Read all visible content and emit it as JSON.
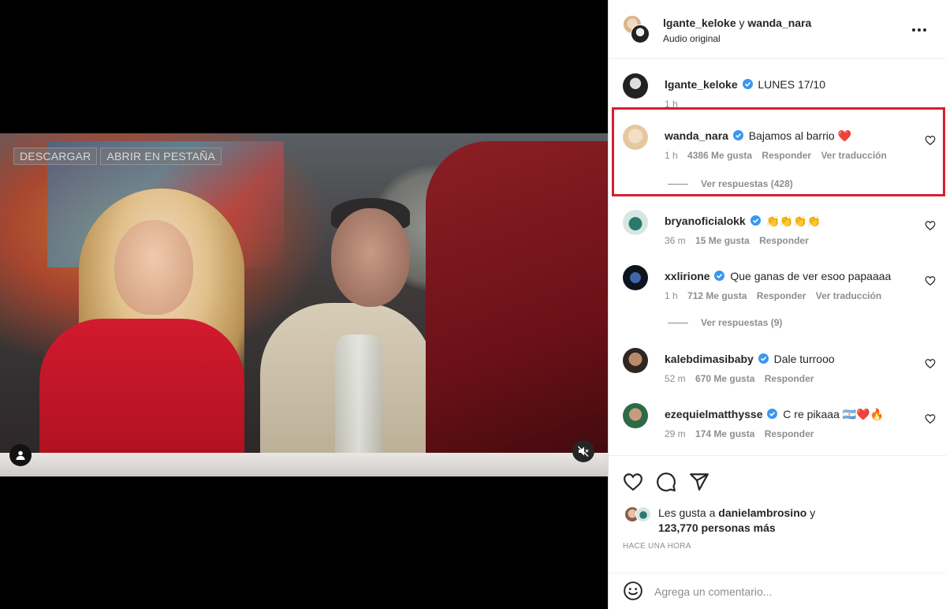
{
  "video": {
    "buttons": [
      "DESCARGAR",
      "ABRIR EN PESTAÑA"
    ]
  },
  "header": {
    "user1": "lgante_keloke",
    "connector": "y",
    "user2": "wanda_nara",
    "audio": "Audio original"
  },
  "caption": {
    "user": "lgante_keloke",
    "text": "LUNES 17/10",
    "time": "1 h"
  },
  "comments": [
    {
      "user": "wanda_nara",
      "text": "Bajamos al barrio ❤️",
      "time": "1 h",
      "likes": "4386 Me gusta",
      "reply": "Responder",
      "translate": "Ver traducción",
      "replies": "Ver respuestas (428)"
    },
    {
      "user": "bryanoficialokk",
      "text": "👏👏👏👏",
      "time": "36 m",
      "likes": "15 Me gusta",
      "reply": "Responder"
    },
    {
      "user": "xxlirione",
      "text": "Que ganas de ver esoo papaaaa",
      "time": "1 h",
      "likes": "712 Me gusta",
      "reply": "Responder",
      "translate": "Ver traducción",
      "replies": "Ver respuestas (9)"
    },
    {
      "user": "kalebdimasibaby",
      "text": "Dale turrooo",
      "time": "52 m",
      "likes": "670 Me gusta",
      "reply": "Responder"
    },
    {
      "user": "ezequielmatthysse",
      "text": "C re pikaaa 🇦🇷❤️🔥",
      "time": "29 m",
      "likes": "174 Me gusta",
      "reply": "Responder"
    }
  ],
  "likes": {
    "prefix": "Les gusta a",
    "user": "danielambrosino",
    "connector": "y",
    "others": "123,770 personas más"
  },
  "time_ago": "HACE UNA HORA",
  "comment_input": {
    "placeholder": "Agrega un comentario..."
  },
  "colors": {
    "verified": "#3897f0",
    "highlight": "#d71f2f",
    "muted_text": "#8e8e8e"
  }
}
